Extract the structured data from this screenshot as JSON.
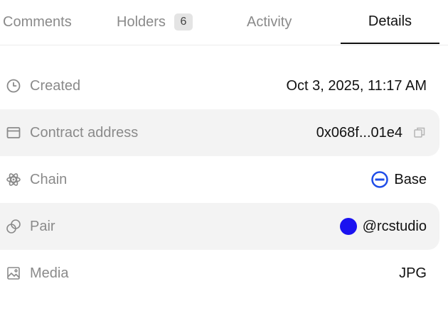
{
  "tabs": {
    "comments": "Comments",
    "holders": "Holders",
    "holders_count": "6",
    "activity": "Activity",
    "details": "Details",
    "active": "Details"
  },
  "details": {
    "created_label": "Created",
    "created_value": "Oct 3, 2025, 11:17 AM",
    "contract_label": "Contract address",
    "contract_value": "0x068f...01e4",
    "chain_label": "Chain",
    "chain_value": "Base",
    "pair_label": "Pair",
    "pair_value": "@rcstudio",
    "media_label": "Media",
    "media_value": "JPG"
  },
  "colors": {
    "chain_base": "#1f4de8",
    "pair_avatar": "#1a12f0",
    "shaded_row": "#f3f3f3"
  },
  "icons": {
    "created": "clock-icon",
    "contract": "contract-card-icon",
    "chain": "atom-icon",
    "pair": "linked-circles-icon",
    "media": "image-icon",
    "copy": "copy-icon"
  }
}
